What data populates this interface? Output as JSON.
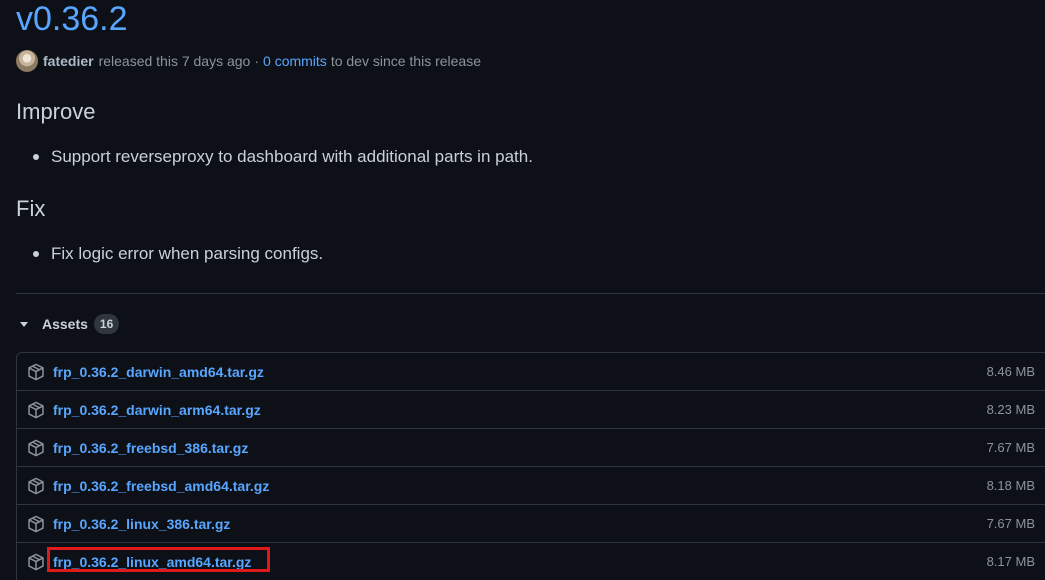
{
  "release": {
    "title": "v0.36.2",
    "author": "fatedier",
    "released_text": "released this 7 days ago",
    "separator": "·",
    "commits_link": "0 commits",
    "commits_suffix": "to dev since this release"
  },
  "notes": {
    "improve_heading": "Improve",
    "improve_items": [
      "Support reverseproxy to dashboard with additional parts in path."
    ],
    "fix_heading": "Fix",
    "fix_items": [
      "Fix logic error when parsing configs."
    ]
  },
  "assets": {
    "label": "Assets",
    "count": "16",
    "items": [
      {
        "name": "frp_0.36.2_darwin_amd64.tar.gz",
        "size": "8.46 MB"
      },
      {
        "name": "frp_0.36.2_darwin_arm64.tar.gz",
        "size": "8.23 MB"
      },
      {
        "name": "frp_0.36.2_freebsd_386.tar.gz",
        "size": "7.67 MB"
      },
      {
        "name": "frp_0.36.2_freebsd_amd64.tar.gz",
        "size": "8.18 MB"
      },
      {
        "name": "frp_0.36.2_linux_386.tar.gz",
        "size": "7.67 MB"
      },
      {
        "name": "frp_0.36.2_linux_amd64.tar.gz",
        "size": "8.17 MB",
        "highlighted": true
      }
    ]
  },
  "colors": {
    "background": "#0d1117",
    "link": "#58a6ff",
    "muted": "#8b949e",
    "highlight": "#e0191b"
  }
}
